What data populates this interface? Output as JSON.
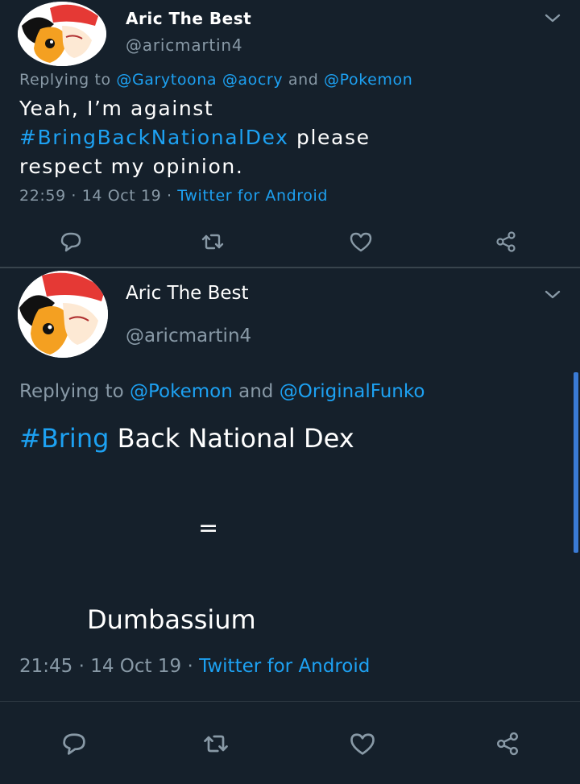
{
  "colors": {
    "background": "#15202b",
    "link": "#1da1f2",
    "secondary_text": "#8899a6",
    "separator": "#38444d"
  },
  "tweets": [
    {
      "name": "Aric The Best",
      "handle": "@aricmartin4",
      "replying_prefix": "Replying to ",
      "reply_targets": [
        "@Garytoona",
        "@aocry",
        "@Pokemon"
      ],
      "reply_joiners": [
        " ",
        " and "
      ],
      "body_line1": "Yeah, I’m against",
      "hashtag": "#BringBackNationalDex",
      "body_line2_rest": " please",
      "body_line3": "respect my opinion.",
      "time": "22:59",
      "dot": " · ",
      "date": "14 Oct 19",
      "source": "Twitter for Android",
      "icons": [
        "reply-icon",
        "retweet-icon",
        "like-icon",
        "share-icon"
      ]
    },
    {
      "name": "Aric The Best",
      "handle": "@aricmartin4",
      "replying_prefix": "Replying to ",
      "reply_targets": [
        "@Pokemon",
        "@OriginalFunko"
      ],
      "reply_joiner": " and ",
      "hashtag": "#Bring",
      "body_line1_rest": " Back National Dex",
      "body_equals": "=",
      "body_last": "Dumbassium",
      "time": "21:45",
      "dot": " · ",
      "date": "14 Oct 19",
      "source": "Twitter for Android",
      "icons": [
        "reply-icon",
        "retweet-icon",
        "like-icon",
        "share-icon"
      ]
    }
  ]
}
